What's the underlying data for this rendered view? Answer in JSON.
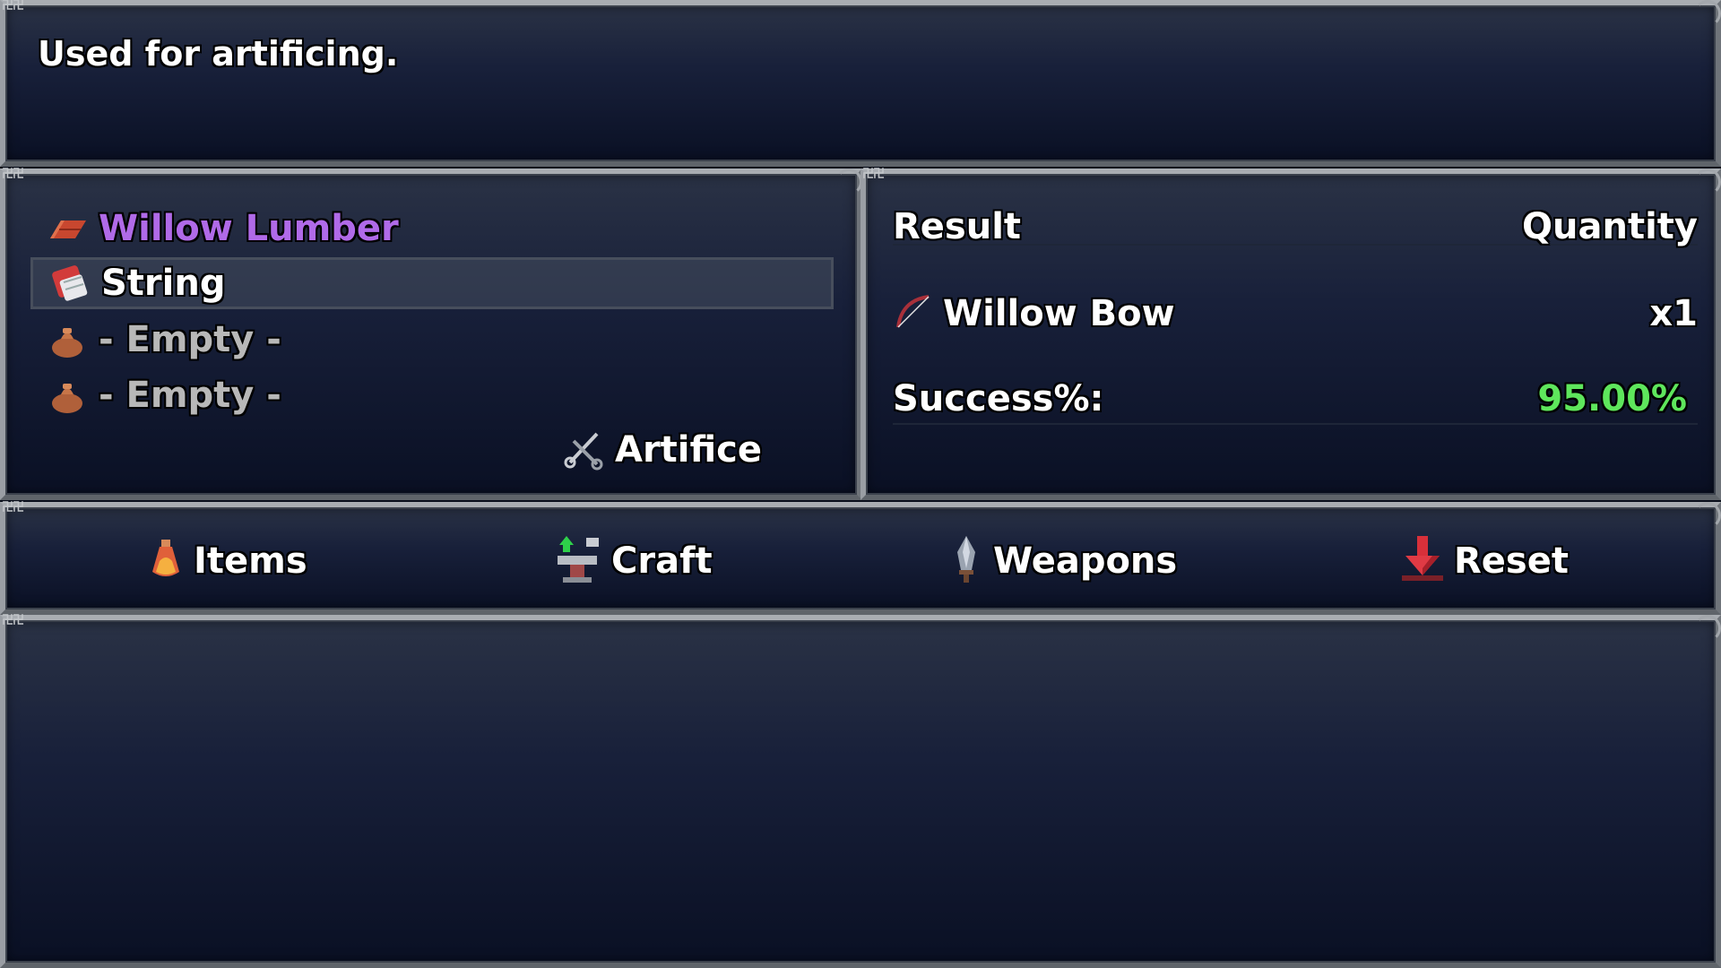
{
  "description": {
    "text": "Used for artificing."
  },
  "ingredients": [
    {
      "label": "Willow Lumber",
      "icon": "lumber-icon",
      "color": "#b06ae8"
    },
    {
      "label": "String",
      "icon": "string-icon",
      "color": "#ffffff"
    },
    {
      "label": "- Empty -",
      "icon": "pouch-icon",
      "color": "#b8b8b8"
    },
    {
      "label": "- Empty -",
      "icon": "pouch-icon",
      "color": "#b8b8b8"
    }
  ],
  "artifice_button": {
    "label": "Artifice",
    "icon": "tools-icon"
  },
  "result": {
    "header_result": "Result",
    "header_quantity": "Quantity",
    "item_name": "Willow Bow",
    "item_icon": "bow-icon",
    "quantity": "x1",
    "success_label": "Success%:",
    "success_value": "95.00%",
    "success_color": "#5ee65c"
  },
  "commands": [
    {
      "label": "Items",
      "icon": "potion-icon"
    },
    {
      "label": "Craft",
      "icon": "craft-icon"
    },
    {
      "label": "Weapons",
      "icon": "weapon-icon"
    },
    {
      "label": "Reset",
      "icon": "reset-arrow-icon"
    }
  ]
}
